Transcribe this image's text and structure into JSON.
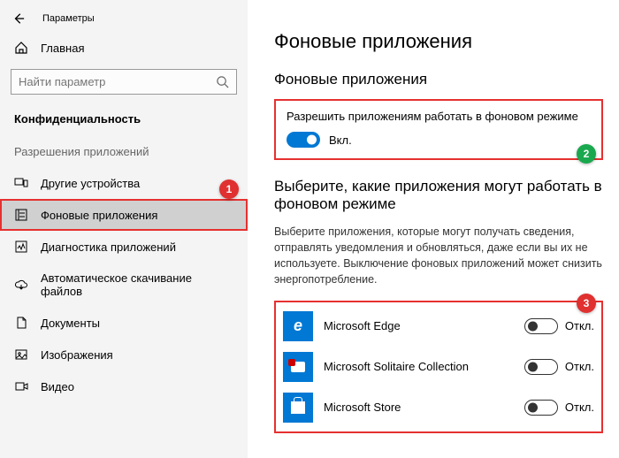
{
  "window": {
    "title": "Параметры"
  },
  "sidebar": {
    "home": "Главная",
    "search_placeholder": "Найти параметр",
    "category": "Конфиденциальность",
    "subcategory": "Разрешения приложений",
    "items": [
      {
        "label": "Другие устройства"
      },
      {
        "label": "Фоновые приложения"
      },
      {
        "label": "Диагностика приложений"
      },
      {
        "label": "Автоматическое скачивание файлов"
      },
      {
        "label": "Документы"
      },
      {
        "label": "Изображения"
      },
      {
        "label": "Видео"
      }
    ]
  },
  "content": {
    "title": "Фоновые приложения",
    "section1": {
      "heading": "Фоновые приложения",
      "label": "Разрешить приложениям работать в фоновом режиме",
      "toggle_state": "Вкл."
    },
    "section2": {
      "heading": "Выберите, какие приложения могут работать в фоновом режиме",
      "description": "Выберите приложения, которые могут получать сведения, отправлять уведомления и обновляться, даже если вы их не используете. Выключение фоновых приложений может снизить энергопотребление."
    },
    "apps": [
      {
        "name": "Microsoft Edge",
        "state": "Откл."
      },
      {
        "name": "Microsoft Solitaire Collection",
        "state": "Откл."
      },
      {
        "name": "Microsoft Store",
        "state": "Откл."
      }
    ]
  },
  "callouts": {
    "c1": "1",
    "c2": "2",
    "c3": "3"
  }
}
